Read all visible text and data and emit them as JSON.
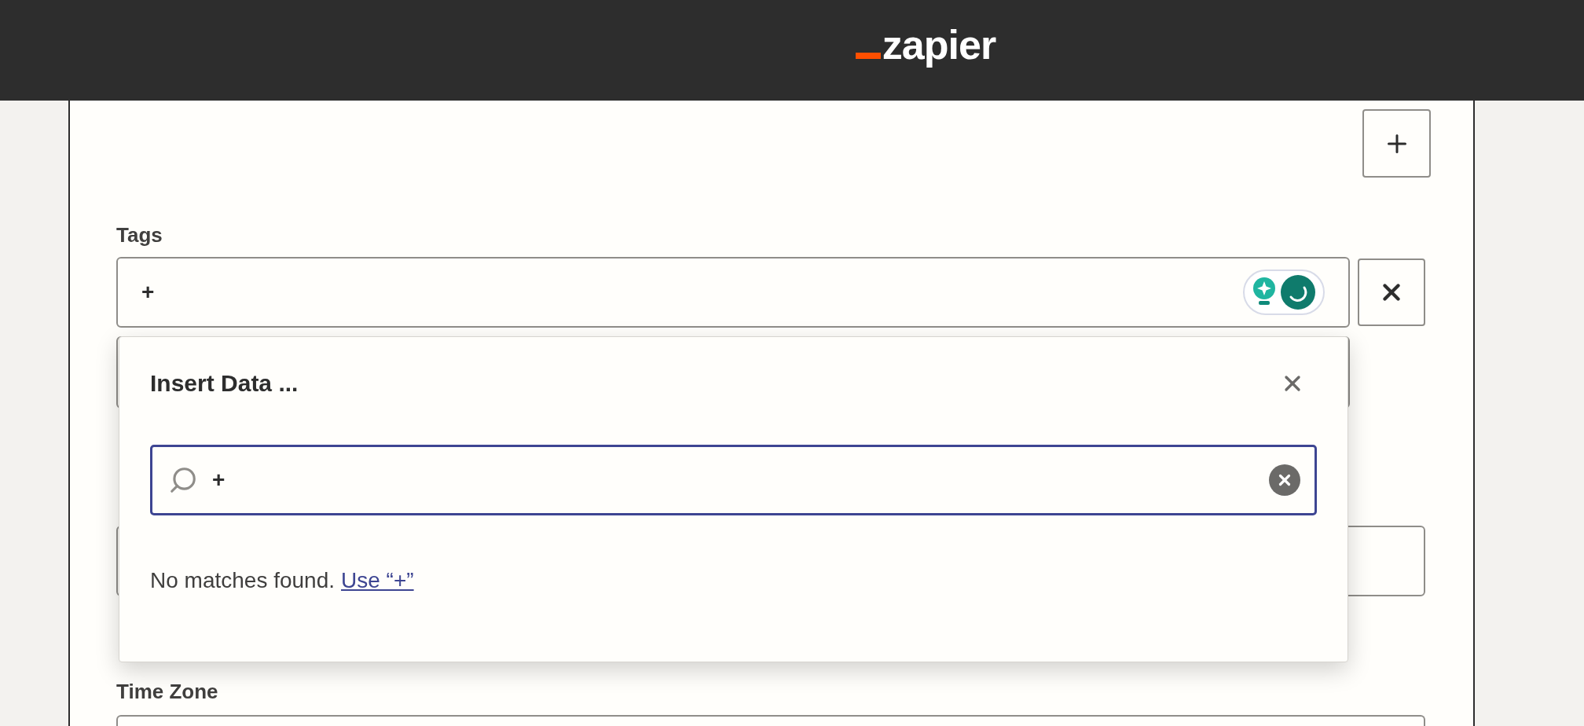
{
  "header": {
    "logo": "zapier"
  },
  "tags_field": {
    "label": "Tags",
    "value": "+",
    "ai_toggle": {
      "on": true
    }
  },
  "time_zone_field": {
    "label": "Time Zone"
  },
  "insert_data": {
    "title": "Insert Data ...",
    "search_value": "+",
    "message": "No matches found.",
    "link": "Use “+”"
  }
}
